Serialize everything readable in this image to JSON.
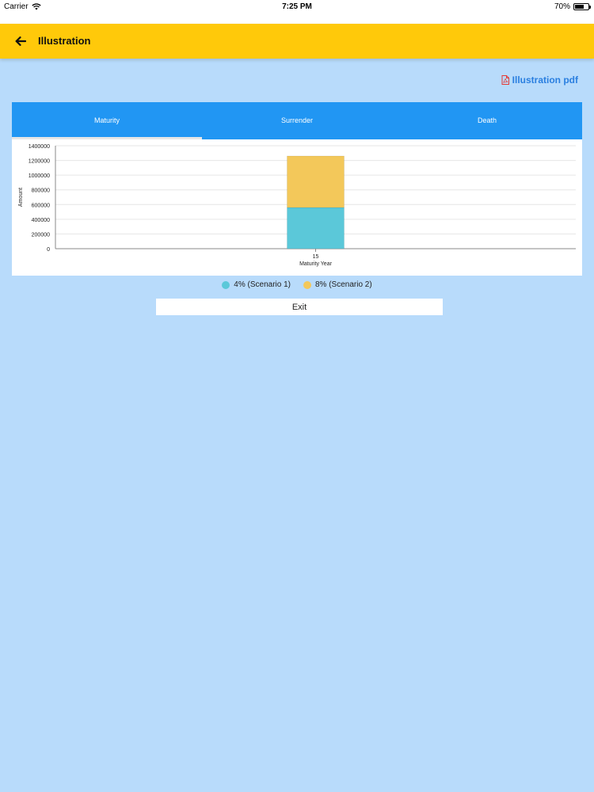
{
  "status_bar": {
    "carrier": "Carrier",
    "time": "7:25 PM",
    "battery": "70%",
    "battery_level": 0.7
  },
  "app_bar": {
    "title": "Illustration"
  },
  "pdf_link": {
    "label": "Illustration pdf"
  },
  "tabs": [
    {
      "label": "Maturity",
      "active": true
    },
    {
      "label": "Surrender",
      "active": false
    },
    {
      "label": "Death",
      "active": false
    }
  ],
  "chart_data": {
    "type": "bar",
    "stacked": true,
    "categories": [
      "15"
    ],
    "series": [
      {
        "name": "4% (Scenario 1)",
        "values": [
          560000
        ],
        "color": "#5bc8d9"
      },
      {
        "name": "8% (Scenario 2)",
        "values": [
          700000
        ],
        "color": "#f3c85a"
      }
    ],
    "xlabel": "Maturity Year",
    "ylabel": "Amount",
    "ylim": [
      0,
      1400000
    ],
    "yticks": [
      0,
      200000,
      400000,
      600000,
      800000,
      1000000,
      1200000,
      1400000
    ],
    "grid": true,
    "legend": "bottom"
  },
  "legend": [
    {
      "label": "4% (Scenario 1)",
      "color": "#5bc8d9"
    },
    {
      "label": "8% (Scenario 2)",
      "color": "#f3c85a"
    }
  ],
  "exit_button": {
    "label": "Exit"
  },
  "colors": {
    "app_bar": "#ffc90a",
    "tabs": "#2196f3",
    "background": "#b8dbfb",
    "pdf_icon": "#e53935",
    "link": "#2a7fe0"
  }
}
